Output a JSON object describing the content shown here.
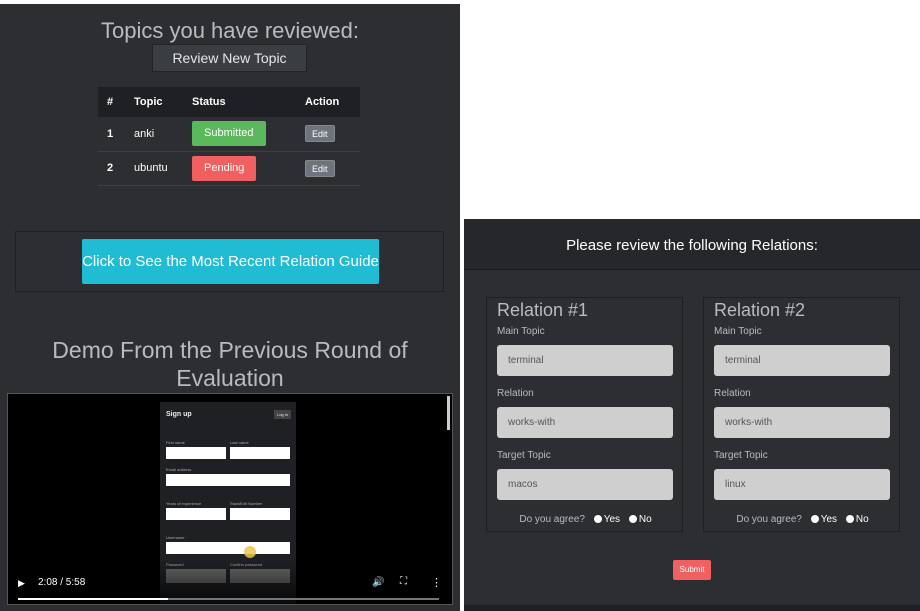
{
  "left": {
    "title": "Topics you have reviewed:",
    "review_new_label": "Review New Topic",
    "table": {
      "headers": [
        "#",
        "Topic",
        "Status",
        "Action"
      ],
      "rows": [
        {
          "num": "1",
          "topic": "anki",
          "status": "Submitted",
          "action": "Edit"
        },
        {
          "num": "2",
          "topic": "ubuntu",
          "status": "Pending",
          "action": "Edit"
        }
      ]
    },
    "guide_label": "Click to See the Most Recent Relation Guide",
    "demo_title": "Demo From the Previous Round of Evaluation",
    "video": {
      "time": "2:08 / 5:58",
      "progress": 0.357,
      "form_title": "Sign up",
      "form_login": "Log in",
      "labels": {
        "first_name": "First name",
        "last_name": "Last name",
        "email": "Email address",
        "years": "Years of experience",
        "phone": "StackEdit Number",
        "username": "Username",
        "password": "Password",
        "confirm": "Confirm password"
      }
    }
  },
  "right": {
    "title": "Please review the following Relations:",
    "relations": [
      {
        "title": "Relation #1",
        "main_label": "Main Topic",
        "main": "terminal",
        "relation_label": "Relation",
        "relation": "works-with",
        "target_label": "Target Topic",
        "target": "macos",
        "agree": "Do you agree?",
        "yes": "Yes",
        "no": "No"
      },
      {
        "title": "Relation #2",
        "main_label": "Main Topic",
        "main": "terminal",
        "relation_label": "Relation",
        "relation": "works-with",
        "target_label": "Target Topic",
        "target": "linux",
        "agree": "Do you agree?",
        "yes": "Yes",
        "no": "No"
      }
    ],
    "submit_label": "Submit"
  },
  "colors": {
    "panel_bg": "#2c2e31",
    "submitted": "#5cb85c",
    "pending": "#f06060",
    "guide_button": "#1fbcd3",
    "submit": "#f06060"
  }
}
